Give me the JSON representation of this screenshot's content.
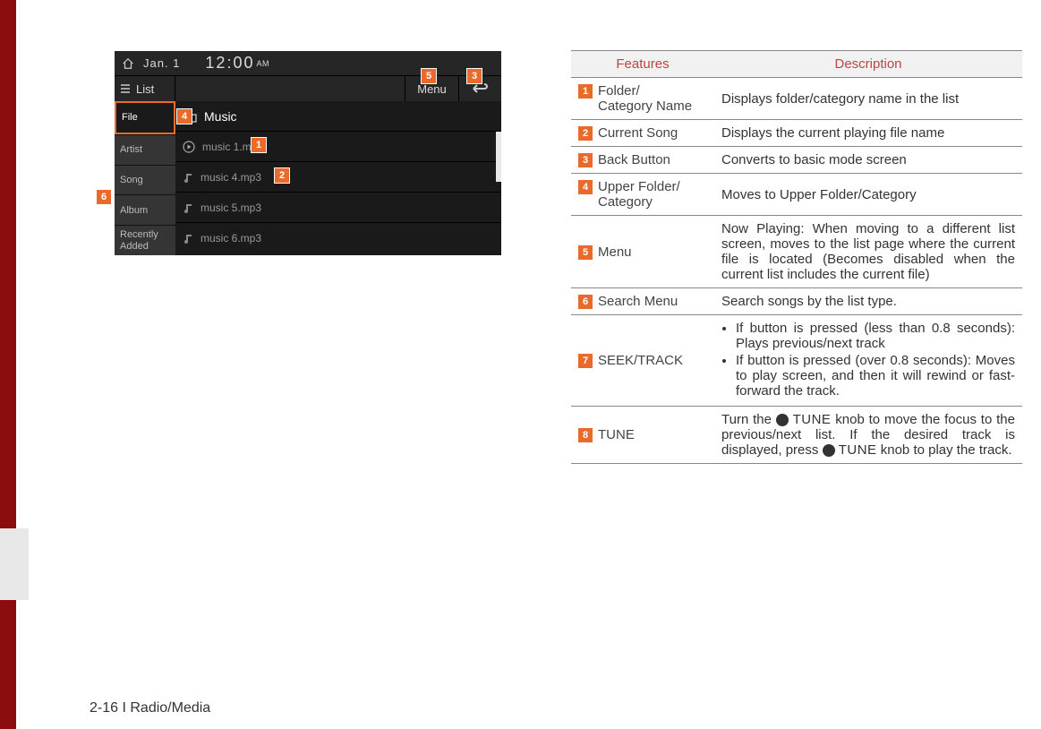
{
  "footer": "2-16 I Radio/Media",
  "device": {
    "date": "Jan. 1",
    "time": "12:00",
    "ampm": "AM",
    "list_label": "List",
    "menu_label": "Menu",
    "categories": [
      "File",
      "Artist",
      "Song",
      "Album",
      "Recently Added"
    ],
    "selected_category_index": 0,
    "folder_title": "Music",
    "tracks": [
      "music 1.mp3",
      "music 4.mp3",
      "music 5.mp3",
      "music 6.mp3"
    ]
  },
  "callouts": {
    "c1": "1",
    "c2": "2",
    "c3": "3",
    "c4": "4",
    "c5": "5",
    "c6": "6"
  },
  "table": {
    "head_features": "Features",
    "head_description": "Description",
    "rows": [
      {
        "num": "1",
        "feat_line1": "Folder/",
        "feat_line2": "Category Name",
        "desc": "Displays folder/category name in the list"
      },
      {
        "num": "2",
        "feat": "Current Song",
        "desc": "Displays the current playing file name"
      },
      {
        "num": "3",
        "feat": "Back Button",
        "desc": "Converts to basic mode screen"
      },
      {
        "num": "4",
        "feat_line1": "Upper Folder/",
        "feat_line2": "Category",
        "desc": "Moves to Upper Folder/Category"
      },
      {
        "num": "5",
        "feat": "Menu",
        "desc": "Now Playing: When moving to a different list screen, moves to the list page where the current file is located (Becomes disabled when the current list includes the current file)"
      },
      {
        "num": "6",
        "feat": "Search Menu",
        "desc": "Search songs by the list type."
      },
      {
        "num": "7",
        "feat": "SEEK/TRACK",
        "bullets": [
          "If button is pressed (less than 0.8 seconds): Plays previous/next track",
          "If button is pressed (over 0.8 seconds): Moves to play screen, and then it will rewind or fast-forward the track."
        ]
      },
      {
        "num": "8",
        "feat": "TUNE",
        "tune_pre": "Turn the ",
        "tune_label1": "TUNE",
        "tune_mid": " knob to move the focus to the previous/next list. If the desired track is displayed, press ",
        "tune_label2": "TUNE",
        "tune_post": " knob to play the track."
      }
    ]
  }
}
